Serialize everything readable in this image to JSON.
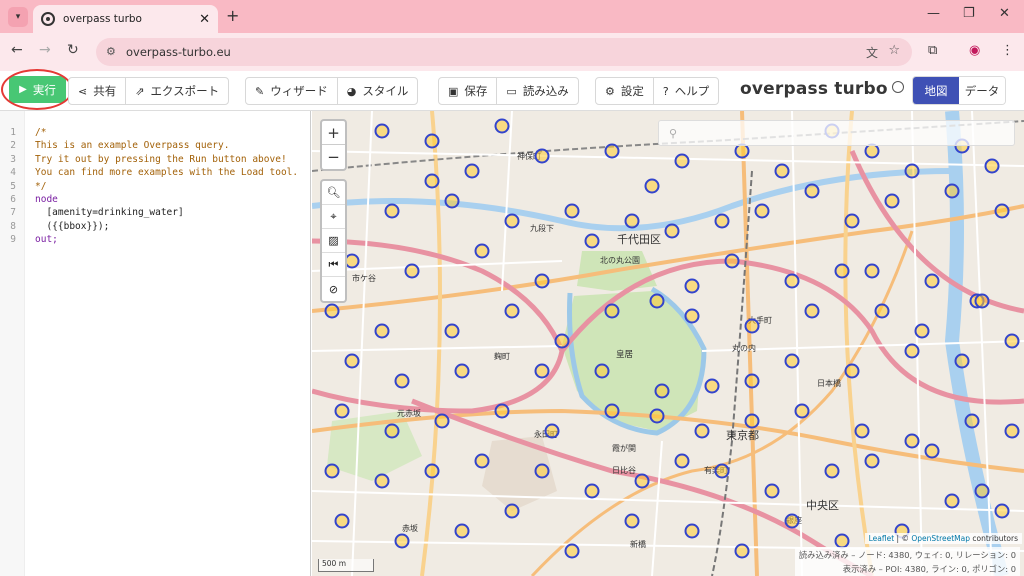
{
  "browser": {
    "tab_title": "overpass turbo",
    "url": "overpass-turbo.eu"
  },
  "toolbar": {
    "run_label": "実行",
    "share_label": "共有",
    "export_label": "エクスポート",
    "wizard_label": "ウィザード",
    "style_label": "スタイル",
    "save_label": "保存",
    "load_label": "読み込み",
    "settings_label": "設定",
    "help_label": "ヘルプ",
    "brand": "overpass turbo",
    "tab_map": "地図",
    "tab_data": "データ"
  },
  "editor": {
    "line_numbers": [
      "1",
      "2",
      "3",
      "4",
      "5",
      "6",
      "7",
      "8",
      "9"
    ],
    "lines": [
      "/*",
      "This is an example Overpass query.",
      "Try it out by pressing the Run button above!",
      "You can find more examples with the Load tool.",
      "*/",
      "node",
      "  [amenity=drinking_water]",
      "  ({{bbox}});",
      "out;"
    ]
  },
  "map": {
    "attribution_leaflet": "Leaflet",
    "attribution_sep": " | © ",
    "attribution_osm": "OpenStreetMap",
    "attribution_tail": " contributors",
    "stats_loaded": "読み込み済み – ノード: 4380, ウェイ: 0, リレーション: 0",
    "stats_shown": "表示済み – POI: 4380, ライン: 0, ポリゴン: 0",
    "scale_label": "500 m",
    "labels": {
      "chiyoda": "千代田区",
      "kokyo": "皇居",
      "tokyo": "東京都",
      "chuo": "中央区",
      "kitanomaru": "北の丸公園",
      "jimbocho": "神保町",
      "kojimachi": "麹町",
      "nagatacho": "永田町",
      "kasumigaseki": "霞が関",
      "marunouchi": "丸の内",
      "nihombashi": "日本橋",
      "otemachi": "大手町",
      "yurakucho": "有楽町",
      "ginza": "銀座",
      "shinbashi": "新橋",
      "hibiya": "日比谷",
      "ichigaya": "市ケ谷",
      "kudan": "九段下",
      "akasaka": "赤坂",
      "motoakasaka": "元赤坂"
    }
  },
  "colors": {
    "run_green": "#48c774",
    "marker_stroke": "#3344cc",
    "marker_fill": "#ffcc33",
    "active_tab": "#3f51b5"
  }
}
